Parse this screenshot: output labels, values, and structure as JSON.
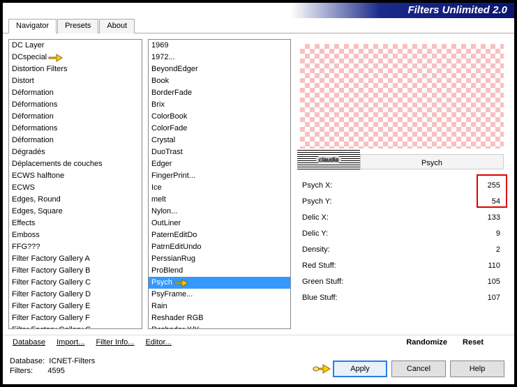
{
  "title": "Filters Unlimited 2.0",
  "tabs": [
    {
      "label": "Navigator",
      "active": true
    },
    {
      "label": "Presets",
      "active": false
    },
    {
      "label": "About",
      "active": false
    }
  ],
  "categories": [
    "DC Layer",
    "DCspecial",
    "Distortion Filters",
    "Distort",
    "Déformation",
    "Déformations",
    "Déformation",
    "Déformations",
    "Déformation",
    "Dégradés",
    "Déplacements de couches",
    "ECWS halftone",
    "ECWS",
    "Edges, Round",
    "Edges, Square",
    "Effects",
    "Emboss",
    "FFG???",
    "Filter Factory Gallery A",
    "Filter Factory Gallery B",
    "Filter Factory Gallery C",
    "Filter Factory Gallery D",
    "Filter Factory Gallery E",
    "Filter Factory Gallery F",
    "Filter Factory Gallery G"
  ],
  "category_pointer_index": 1,
  "filters": [
    "1969",
    "1972...",
    "BeyondEdger",
    "Book",
    "BorderFade",
    "Brix",
    "ColorBook",
    "ColorFade",
    "Crystal",
    "DuoTrast",
    "Edger",
    "FingerPrint...",
    "Ice",
    "melt",
    "Nylon...",
    "OutLiner",
    "PaternEditDo",
    "PatrnEditUndo",
    "PerssianRug",
    "ProBlend",
    "Psych",
    "PsyFrame...",
    "Rain",
    "Reshader RGB",
    "Reshader X/Y"
  ],
  "filter_selected_index": 20,
  "filter_pointer_index": 20,
  "current_filter_name": "Psych",
  "watermark_text": "claudia",
  "params": [
    {
      "label": "Psych X:",
      "value": 255
    },
    {
      "label": "Psych Y:",
      "value": 54
    },
    {
      "label": "Delic X:",
      "value": 133
    },
    {
      "label": "Delic Y:",
      "value": 9
    },
    {
      "label": "Density:",
      "value": 2
    },
    {
      "label": "Red Stuff:",
      "value": 110
    },
    {
      "label": "Green Stuff:",
      "value": 105
    },
    {
      "label": "Blue Stuff:",
      "value": 107
    }
  ],
  "links": {
    "database": "Database",
    "import": "Import...",
    "filter_info": "Filter Info...",
    "editor": "Editor...",
    "randomize": "Randomize",
    "reset": "Reset"
  },
  "status": {
    "db_label": "Database:",
    "db_value": "ICNET-Filters",
    "filters_label": "Filters:",
    "filters_value": "4595"
  },
  "buttons": {
    "apply": "Apply",
    "cancel": "Cancel",
    "help": "Help"
  }
}
